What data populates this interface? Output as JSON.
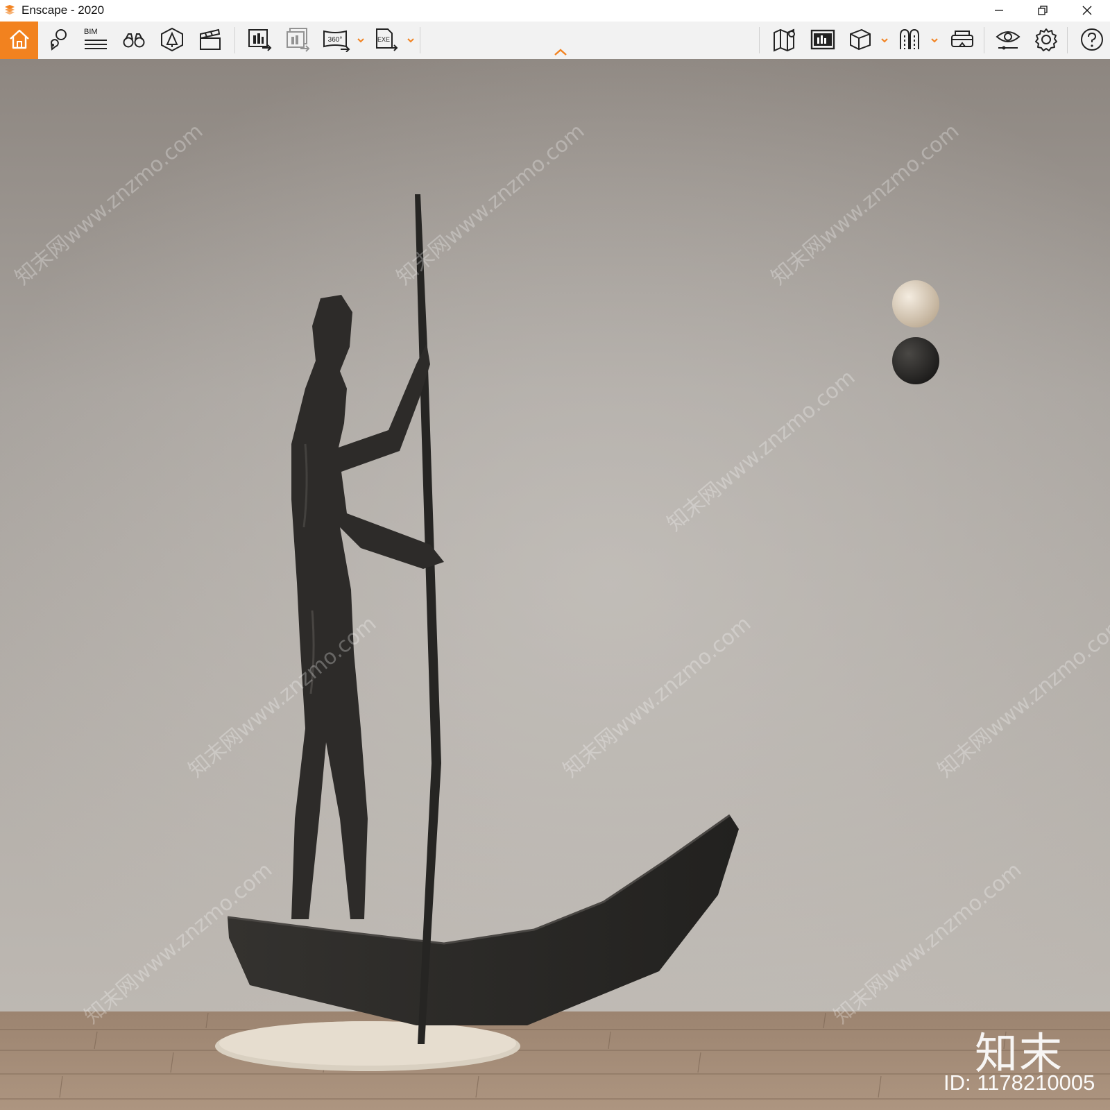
{
  "window": {
    "title": "Enscape - 2020"
  },
  "colors": {
    "accent": "#f2821f",
    "toolbar_bg": "#f2f2f2",
    "wall": "#b9b4ae",
    "floor": "#a48a72"
  },
  "toolbar": {
    "home": {
      "icon": "home-icon"
    },
    "left_tools": [
      {
        "name": "views-icon"
      },
      {
        "name": "bim-icon",
        "label": "BIM"
      },
      {
        "name": "binoculars-icon"
      },
      {
        "name": "asset-library-icon"
      },
      {
        "name": "video-editor-icon"
      },
      {
        "name": "render-image-icon"
      },
      {
        "name": "batch-render-icon"
      },
      {
        "name": "panorama-360-icon",
        "label": "360°"
      },
      {
        "name": "export-exe-icon",
        "label": "EXE"
      }
    ],
    "right_tools": [
      {
        "name": "map-icon"
      },
      {
        "name": "rendering-view-icon"
      },
      {
        "name": "cube-icon"
      },
      {
        "name": "clipping-icon"
      },
      {
        "name": "vr-headset-icon"
      },
      {
        "name": "visual-settings-icon"
      },
      {
        "name": "gear-icon"
      },
      {
        "name": "help-icon"
      }
    ]
  },
  "watermark": {
    "brand": "知末",
    "id": "ID: 1178210005",
    "diagonal_text": "知末网www.znzmo.com"
  }
}
